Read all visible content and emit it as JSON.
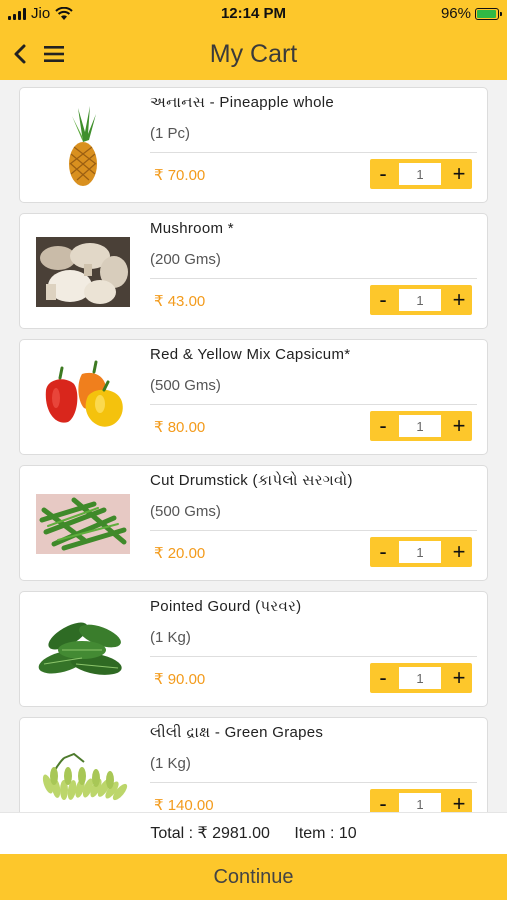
{
  "status_bar": {
    "carrier": "Jio",
    "time": "12:14 PM",
    "battery_percent": "96%",
    "battery_level": 0.96,
    "icons": [
      "signal-icon",
      "wifi-icon",
      "battery-icon"
    ]
  },
  "header": {
    "title": "My Cart",
    "icons": [
      "back-icon",
      "menu-icon"
    ],
    "accent_color": "#fdc72b"
  },
  "cart": {
    "items": [
      {
        "name": "અનાનસ - Pineapple whole",
        "unit": "(1 Pc)",
        "price": "₹ 70.00",
        "qty": "1",
        "image_icon": "pineapple-image"
      },
      {
        "name": "Mushroom *",
        "unit": "(200 Gms)",
        "price": "₹ 43.00",
        "qty": "1",
        "image_icon": "mushroom-image"
      },
      {
        "name": "Red & Yellow Mix Capsicum*",
        "unit": "(500 Gms)",
        "price": "₹ 80.00",
        "qty": "1",
        "image_icon": "capsicum-image"
      },
      {
        "name": "Cut Drumstick (કાપેલો સરગવો)",
        "unit": "(500 Gms)",
        "price": "₹ 20.00",
        "qty": "1",
        "image_icon": "drumstick-image"
      },
      {
        "name": "Pointed Gourd (પરવર)",
        "unit": "(1 Kg)",
        "price": "₹ 90.00",
        "qty": "1",
        "image_icon": "pointed-gourd-image"
      },
      {
        "name": "લીલી દ્રાક્ષ - Green Grapes",
        "unit": "(1 Kg)",
        "price": "₹ 140.00",
        "qty": "1",
        "image_icon": "green-grapes-image"
      }
    ],
    "minus_label": "-",
    "plus_label": "+",
    "price_color": "#f39b1c"
  },
  "summary": {
    "total": "Total : ₹ 2981.00",
    "items": "Item : 10"
  },
  "continue_label": "Continue"
}
